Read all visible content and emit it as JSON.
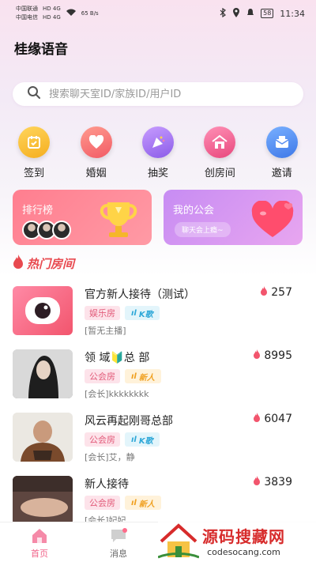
{
  "status_bar": {
    "carrier1": "中国联通",
    "carrier2": "中国电信",
    "net1": "HD 4G",
    "net2": "HD 4G",
    "speed": "65 B/s",
    "battery": "58",
    "time": "11:34"
  },
  "header": {
    "title": "桂缘语音"
  },
  "search": {
    "placeholder": "搜索聊天室ID/家族ID/用户ID"
  },
  "quick_actions": [
    {
      "label": "签到",
      "icon": "calendar-check-icon",
      "color": "#f8c23a"
    },
    {
      "label": "婚姻",
      "icon": "heart-icon",
      "color": "#ff7b7b"
    },
    {
      "label": "抽奖",
      "icon": "party-popper-icon",
      "color": "#b07cf0"
    },
    {
      "label": "创房间",
      "icon": "house-icon",
      "color": "#f56b9a"
    },
    {
      "label": "邀请",
      "icon": "envelope-icon",
      "color": "#4f8ff0"
    }
  ],
  "cards": {
    "rank": {
      "title": "排行榜"
    },
    "guild": {
      "title": "我的公会",
      "pill": "聊天会上瘾~"
    }
  },
  "hot_section": {
    "title": "热门房间"
  },
  "rooms": [
    {
      "name": "官方新人接待（测试）",
      "hot": "257",
      "type": "娱乐房",
      "badge": "K歌",
      "badge_kind": "k",
      "sub": "[暂无主播]"
    },
    {
      "name": "领 域🔰总 部",
      "hot": "8995",
      "type": "公会房",
      "badge": "新人",
      "badge_kind": "new",
      "sub": "[会长]kkkkkkkk"
    },
    {
      "name": "风云再起刚哥总部",
      "hot": "6047",
      "type": "公会房",
      "badge": "K歌",
      "badge_kind": "k",
      "sub": "[会长]艾，静"
    },
    {
      "name": "新人接待",
      "hot": "3839",
      "type": "公会房",
      "badge": "新人",
      "badge_kind": "new",
      "sub": "[会长]妃妃"
    }
  ],
  "tabbar": {
    "home": "首页",
    "messages": "消息"
  },
  "watermark": {
    "cn": "源码搜藏网",
    "url": "codesocang.com"
  }
}
